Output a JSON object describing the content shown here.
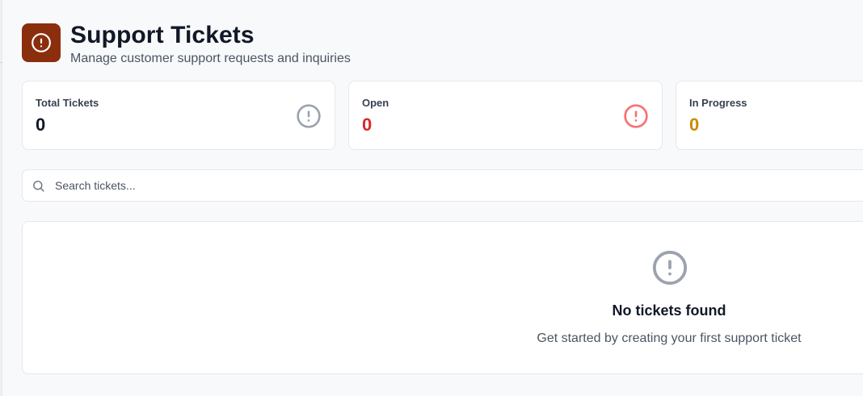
{
  "header": {
    "icon": "alert-circle-icon",
    "brand_color": "#8b2e0e",
    "title": "Support Tickets",
    "subtitle": "Manage customer support requests and inquiries"
  },
  "stats": [
    {
      "label": "Total Tickets",
      "value": "0",
      "color": "#111827",
      "icon": "alert-circle-icon",
      "icon_color": "#9ca3af"
    },
    {
      "label": "Open",
      "value": "0",
      "color": "#dc2626",
      "icon": "alert-circle-icon",
      "icon_color": "#f87171"
    },
    {
      "label": "In Progress",
      "value": "0",
      "color": "#ca8a04"
    }
  ],
  "search": {
    "icon": "search-icon",
    "placeholder": "Search tickets...",
    "value": ""
  },
  "empty_state": {
    "icon": "alert-circle-icon",
    "title": "No tickets found",
    "text": "Get started by creating your first support ticket"
  }
}
